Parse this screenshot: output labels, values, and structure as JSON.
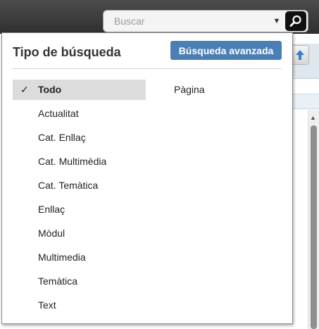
{
  "search": {
    "placeholder": "Buscar"
  },
  "icons": {
    "dropdown": "chevron-down-icon",
    "search": "magnifier-icon",
    "check": "check-icon",
    "background_action": "arrow-up-icon"
  },
  "panel": {
    "title": "Tipo de búsqueda",
    "advanced_button_label": "Búsqueda avanzada",
    "check_mark": "✓",
    "types": [
      {
        "label": "Todo",
        "selected": true
      },
      {
        "label": "Actualitat",
        "selected": false
      },
      {
        "label": "Cat. Enllaç",
        "selected": false
      },
      {
        "label": "Cat. Multimèdia",
        "selected": false
      },
      {
        "label": "Cat. Temàtica",
        "selected": false
      },
      {
        "label": "Enllaç",
        "selected": false
      },
      {
        "label": "Mòdul",
        "selected": false
      },
      {
        "label": "Multimedia",
        "selected": false
      },
      {
        "label": "Temàtica",
        "selected": false
      },
      {
        "label": "Text",
        "selected": false
      }
    ],
    "secondary_types": [
      {
        "label": "Pàgina"
      }
    ]
  },
  "colors": {
    "accent": "#4a7fb6",
    "topbar": "#3a3a3a",
    "selected_row": "#dcdcdc"
  }
}
